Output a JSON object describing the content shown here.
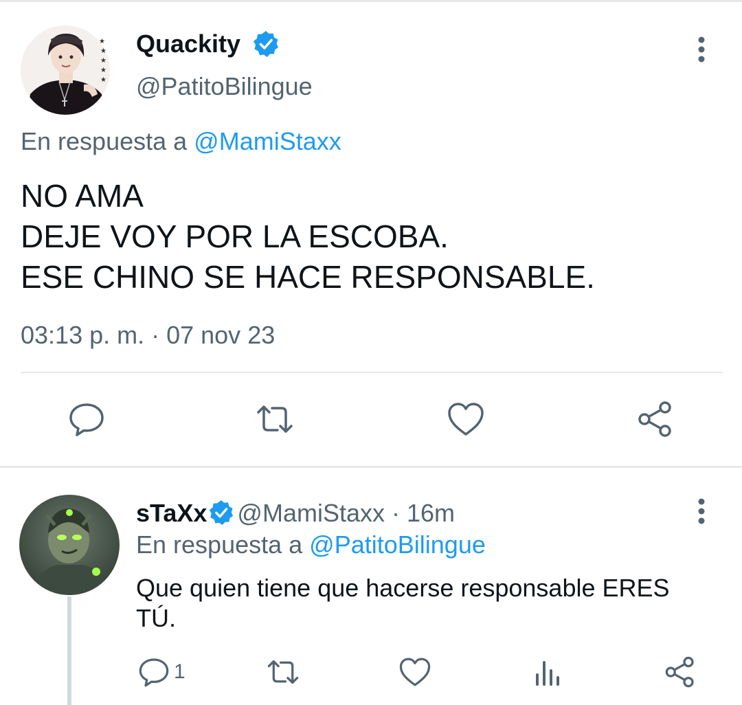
{
  "tweet": {
    "author_name": "Quackity",
    "handle": "@PatitoBilingue",
    "reply_prefix": "En respuesta a",
    "reply_mention": "@MamiStaxx",
    "body_lines": [
      "NO AMA",
      "DEJE VOY POR LA ESCOBA.",
      "ESE CHINO SE HACE RESPONSABLE."
    ],
    "timestamp": "03:13 p. m. · 07 nov 23"
  },
  "reply": {
    "author_name": "sTaXx",
    "handle": "@MamiStaxx",
    "time": " · 16m",
    "reply_prefix": "En respuesta a",
    "reply_mention": "@PatitoBilingue",
    "body": "Que quien tiene que hacerse responsable ERES TÚ.",
    "reply_count": "1"
  },
  "icons": {
    "verified": "verified-badge-icon",
    "more": "more-vertical-icon",
    "reply": "reply-icon",
    "retweet": "retweet-icon",
    "like": "heart-icon",
    "share": "share-icon",
    "views": "views-icon"
  },
  "colors": {
    "accent": "#1d9bf0",
    "secondary_text": "#536471",
    "divider": "#e6e8ea"
  }
}
